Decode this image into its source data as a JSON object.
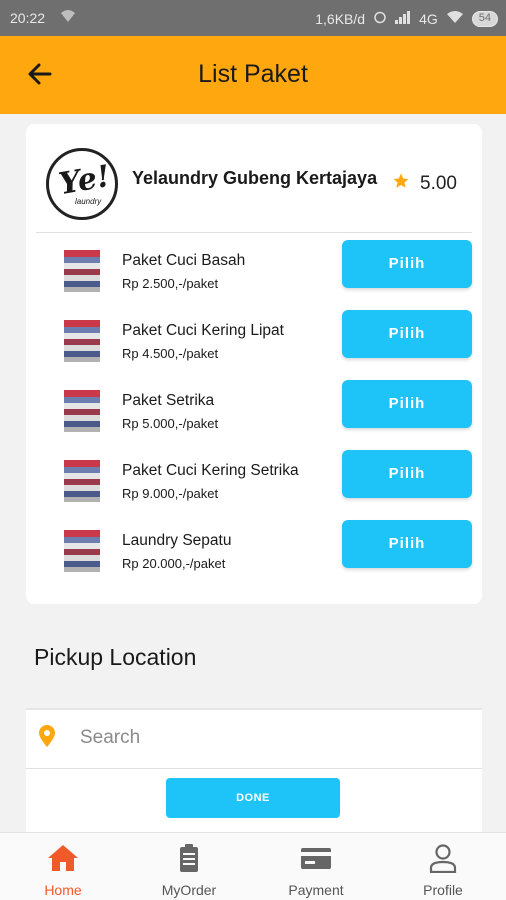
{
  "status_bar": {
    "time": "20:22",
    "speed": "1,6KB/d",
    "network": "4G",
    "battery": "54"
  },
  "app_bar": {
    "title": "List Paket"
  },
  "store": {
    "logo_text": "Ye!",
    "logo_subtext": "laundry",
    "name": "Yelaundry Gubeng Kertajaya",
    "rating": "5.00"
  },
  "packages": [
    {
      "name": "Paket Cuci Basah",
      "price": "Rp 2.500,-/paket",
      "button": "Pilih"
    },
    {
      "name": "Paket Cuci Kering Lipat",
      "price": "Rp 4.500,-/paket",
      "button": "Pilih"
    },
    {
      "name": "Paket Setrika",
      "price": "Rp 5.000,-/paket",
      "button": "Pilih"
    },
    {
      "name": "Paket Cuci Kering Setrika",
      "price": "Rp 9.000,-/paket",
      "button": "Pilih"
    },
    {
      "name": "Laundry Sepatu",
      "price": "Rp 20.000,-/paket",
      "button": "Pilih"
    }
  ],
  "pickup": {
    "title": "Pickup Location",
    "search_placeholder": "Search",
    "done_label": "DONE"
  },
  "bottom_nav": [
    {
      "label": "Home",
      "icon": "home-icon",
      "active": true
    },
    {
      "label": "MyOrder",
      "icon": "clipboard-icon",
      "active": false
    },
    {
      "label": "Payment",
      "icon": "card-icon",
      "active": false
    },
    {
      "label": "Profile",
      "icon": "person-icon",
      "active": false
    }
  ],
  "colors": {
    "app_bar": "#ffa70f",
    "button": "#1ec3f7",
    "active_nav": "#f05a28",
    "star": "#ffa70f"
  }
}
